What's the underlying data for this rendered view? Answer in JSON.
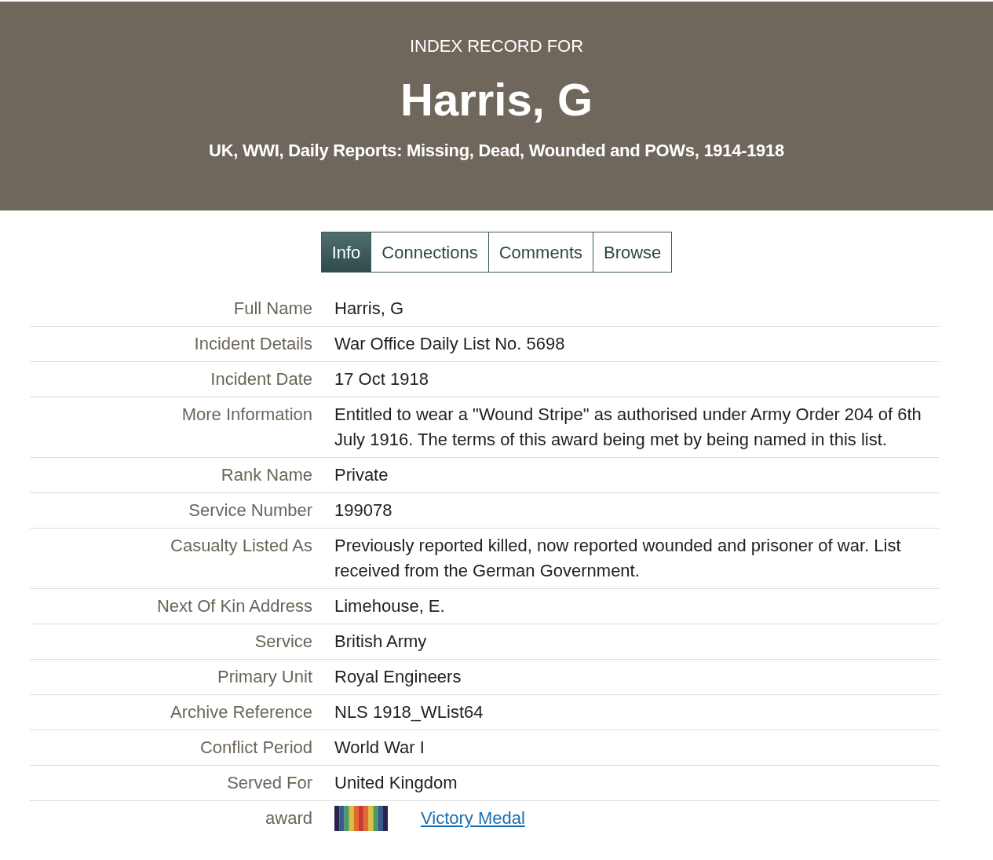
{
  "header": {
    "eyebrow": "INDEX RECORD FOR",
    "name": "Harris, G",
    "collection": "UK, WWI, Daily Reports: Missing, Dead, Wounded and POWs, 1914-1918"
  },
  "tabs": [
    {
      "label": "Info",
      "selected": true
    },
    {
      "label": "Connections",
      "selected": false
    },
    {
      "label": "Comments",
      "selected": false
    },
    {
      "label": "Browse",
      "selected": false
    }
  ],
  "fields": [
    {
      "kind": "text",
      "label": "Full Name",
      "value": "Harris, G"
    },
    {
      "kind": "text",
      "label": "Incident Details",
      "value": "War Office Daily List No. 5698"
    },
    {
      "kind": "text",
      "label": "Incident Date",
      "value": "17 Oct 1918"
    },
    {
      "kind": "text",
      "label": "More Information",
      "value": "Entitled to wear a \"Wound Stripe\" as authorised under Army Order 204 of 6th July 1916. The terms of this award being met by being named in this list."
    },
    {
      "kind": "text",
      "label": "Rank Name",
      "value": "Private"
    },
    {
      "kind": "text",
      "label": "Service Number",
      "value": "199078"
    },
    {
      "kind": "text",
      "label": "Casualty Listed As",
      "value": "Previously reported killed, now reported wounded and prisoner of war. List received from the German Government."
    },
    {
      "kind": "text",
      "label": "Next Of Kin Address",
      "value": "Limehouse, E."
    },
    {
      "kind": "text",
      "label": "Service",
      "value": "British Army"
    },
    {
      "kind": "text",
      "label": "Primary Unit",
      "value": "Royal Engineers"
    },
    {
      "kind": "text",
      "label": "Archive Reference",
      "value": "NLS 1918_WList64"
    },
    {
      "kind": "text",
      "label": "Conflict Period",
      "value": "World War I"
    },
    {
      "kind": "text",
      "label": "Served For",
      "value": "United Kingdom"
    },
    {
      "kind": "award",
      "label": "award",
      "value": "Victory Medal"
    }
  ]
}
